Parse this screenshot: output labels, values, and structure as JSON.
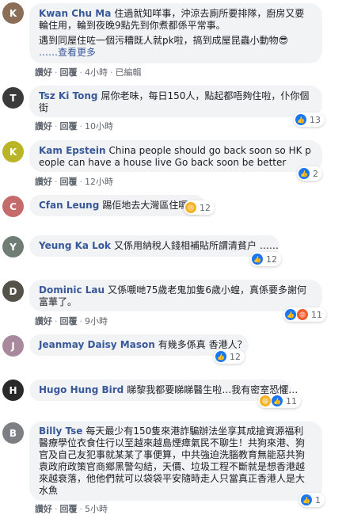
{
  "comments": [
    {
      "name": "Kwan Chu Ma",
      "text": "住過就知咩事，沖涼去廁所要排隊，廚房又要輪住用，輪到夜晚9點先到你煮都係平常事。",
      "text2": "遇到同屋住咗一個污糟既人就pk啦，搞到成屋昆蟲小動物😎",
      "more": "……查看更多",
      "like": "讚好",
      "reply": "回覆",
      "time": "4小時",
      "edited": "已編輯"
    },
    {
      "name": "Tsz Ki Tong",
      "text": "屌你老味，每日150人，點起都唔夠住啦，仆你個街",
      "like": "讚好",
      "reply": "回覆",
      "time": "10小時",
      "reactions": [
        "like"
      ],
      "count": "13"
    },
    {
      "name": "Kam Epstein",
      "text": "China people should go back soon so HK people can have a house live Go back soon be better",
      "like": "讚好",
      "reply": "回覆",
      "time": "12小時",
      "reactions": [
        "like"
      ],
      "count": "2"
    },
    {
      "name": "Cfan Leung",
      "text": "踢佢地去大灣區住囉",
      "reactions": [
        "sad"
      ],
      "count": "12"
    },
    {
      "name": "Yeung Ka Lok",
      "text": "又係用納稅人錢相補貼所謂清貧户 ……",
      "reactions": [
        "like"
      ],
      "count": "12"
    },
    {
      "name": "Dominic Lau",
      "text": "又係嚫哋75歲老鬼加隻6歲小蝗，真係要多謝何富華了。",
      "like": "讚好",
      "reply": "回覆",
      "time": "9小時",
      "reactions": [
        "like",
        "angry"
      ],
      "count": "11"
    },
    {
      "name": "Jeanmay Daisy Mason",
      "text": "有幾多係真 香港人？",
      "reactions": [
        "like"
      ],
      "count": "12"
    },
    {
      "name": "Hugo Hung Bird",
      "text": "睇黎我都要睇睇醫生啦…我有密室恐懼…",
      "reactions": [
        "haha",
        "like"
      ],
      "count": "11"
    },
    {
      "name": "Billy Tse",
      "text": "每天最少有150隻來港詐騙辦法坐享其成搶資源福利醫療學位衣食住行以至越來越島煙瘴氣民不聊生！共狗來港、狗官及自己友犯事就某某了事便算，中共強迫洗腦教育無能惡共狗袁政府政策官商鄉黑警勾結，天價、垃圾工程不斷就是想香港越來越衰落，他他們就可以袋袋平安隨時走人只當真正香港人是大水魚",
      "like": "讚好",
      "reply": "回覆",
      "time": "5小時",
      "reactions": [
        "like"
      ],
      "count": "1"
    }
  ],
  "colors": {
    "link": "#385898",
    "bubble": "#f2f3f5",
    "meta": "#606770",
    "like": "#1877f2"
  }
}
